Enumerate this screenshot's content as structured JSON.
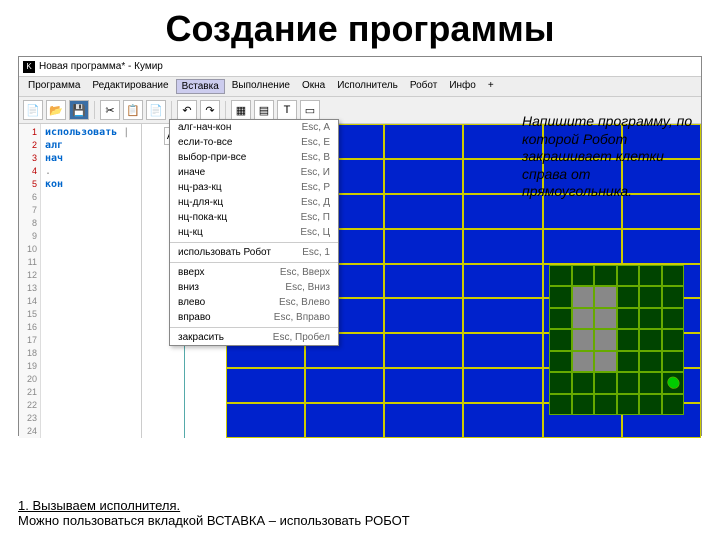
{
  "title": "Создание программы",
  "window_title": "Новая программа* - Кумир",
  "menus": [
    "Программа",
    "Редактирование",
    "Вставка",
    "Выполнение",
    "Окна",
    "Исполнитель",
    "Робот",
    "Инфо",
    "+"
  ],
  "active_menu": 2,
  "line_numbers": [
    "1",
    "2",
    "3",
    "4",
    "5",
    "6",
    "7",
    "8",
    "9",
    "10",
    "11",
    "12",
    "13",
    "14",
    "15",
    "16",
    "17",
    "18",
    "19",
    "20",
    "21",
    "22",
    "23",
    "24"
  ],
  "code": {
    "l1": "использовать",
    "l2": "алг",
    "l3": "нач",
    "l4": ".",
    "l5": "кон"
  },
  "dropdown": [
    {
      "label": "алг-нач-кон",
      "key": "Esc, A"
    },
    {
      "label": "если-то-все",
      "key": "Esc, E"
    },
    {
      "label": "выбор-при-все",
      "key": "Esc, B"
    },
    {
      "label": "иначе",
      "key": "Esc, И"
    },
    {
      "label": "нц-раз-кц",
      "key": "Esc, P"
    },
    {
      "label": "нц-для-кц",
      "key": "Esc, Д"
    },
    {
      "label": "нц-пока-кц",
      "key": "Esc, П"
    },
    {
      "label": "нц-кц",
      "key": "Esc, Ц"
    },
    {
      "sep": true
    },
    {
      "label": "использовать Робот",
      "key": "Esc, 1"
    },
    {
      "sep": true
    },
    {
      "label": "вверх",
      "key": "Esc, Вверх"
    },
    {
      "label": "вниз",
      "key": "Esc, Вниз"
    },
    {
      "label": "влево",
      "key": "Esc, Влево"
    },
    {
      "label": "вправо",
      "key": "Esc, Вправо"
    },
    {
      "sep": true
    },
    {
      "label": "закрасить",
      "key": "Esc, Пробел"
    }
  ],
  "task_text": "Напишите программу, по которой Робот закрашивает клетки справа от прямоугольника.",
  "footer_line1": "1. Вызываем исполнителя.",
  "footer_line2": "Можно пользоваться вкладкой ВСТАВКА – использовать РОБОТ",
  "toolbar_icons": [
    "file",
    "open",
    "save",
    "cut",
    "scissors",
    "copy",
    "paste",
    "undo",
    "redo",
    "|",
    "grid",
    "grid2",
    "text",
    "doc"
  ],
  "sideicons": [
    "A1",
    "rad",
    "X"
  ]
}
